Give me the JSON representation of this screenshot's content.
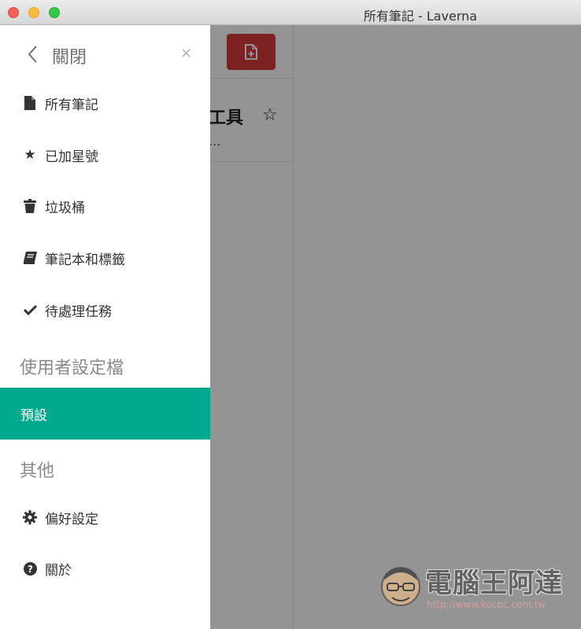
{
  "window": {
    "title": "所有筆記 - Laverna"
  },
  "list": {
    "note_title": "工具",
    "note_snippet": "..."
  },
  "sidebar": {
    "close_label": "關閉",
    "items": [
      {
        "label": "所有筆記",
        "icon": "file-icon"
      },
      {
        "label": "已加星號",
        "icon": "star-icon"
      },
      {
        "label": "垃圾桶",
        "icon": "trash-icon"
      },
      {
        "label": "筆記本和標籤",
        "icon": "book-icon"
      },
      {
        "label": "待處理任務",
        "icon": "check-icon"
      }
    ],
    "profiles_title": "使用者設定檔",
    "profile_default": "預設",
    "other_title": "其他",
    "other_items": [
      {
        "label": "偏好設定",
        "icon": "gear-icon"
      },
      {
        "label": "關於",
        "icon": "question-icon"
      }
    ]
  },
  "watermark": {
    "name": "電腦王阿達",
    "url": "http://www.kocpc.com.tw"
  },
  "colors": {
    "accent": "#00a88e",
    "new_note_button": "#d83b3b"
  }
}
